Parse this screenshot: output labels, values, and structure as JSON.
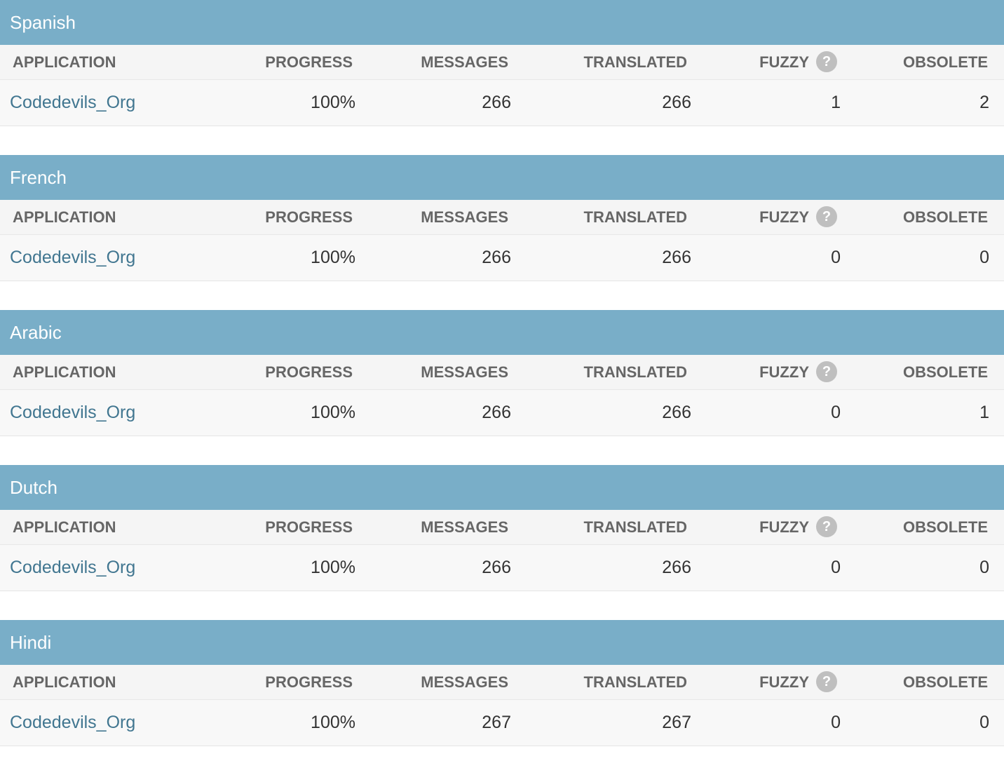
{
  "columns": {
    "application": "APPLICATION",
    "progress": "PROGRESS",
    "messages": "MESSAGES",
    "translated": "TRANSLATED",
    "fuzzy": "FUZZY",
    "obsolete": "OBSOLETE"
  },
  "help_icon_glyph": "?",
  "help_icon_name": "help-icon",
  "colors": {
    "caption_bg": "#79aec8",
    "link": "#417690"
  },
  "languages": [
    {
      "name": "Spanish",
      "app": "Codedevils_Org",
      "progress": "100%",
      "messages": "266",
      "translated": "266",
      "fuzzy": "1",
      "obsolete": "2"
    },
    {
      "name": "French",
      "app": "Codedevils_Org",
      "progress": "100%",
      "messages": "266",
      "translated": "266",
      "fuzzy": "0",
      "obsolete": "0"
    },
    {
      "name": "Arabic",
      "app": "Codedevils_Org",
      "progress": "100%",
      "messages": "266",
      "translated": "266",
      "fuzzy": "0",
      "obsolete": "1"
    },
    {
      "name": "Dutch",
      "app": "Codedevils_Org",
      "progress": "100%",
      "messages": "266",
      "translated": "266",
      "fuzzy": "0",
      "obsolete": "0"
    },
    {
      "name": "Hindi",
      "app": "Codedevils_Org",
      "progress": "100%",
      "messages": "267",
      "translated": "267",
      "fuzzy": "0",
      "obsolete": "0"
    }
  ]
}
